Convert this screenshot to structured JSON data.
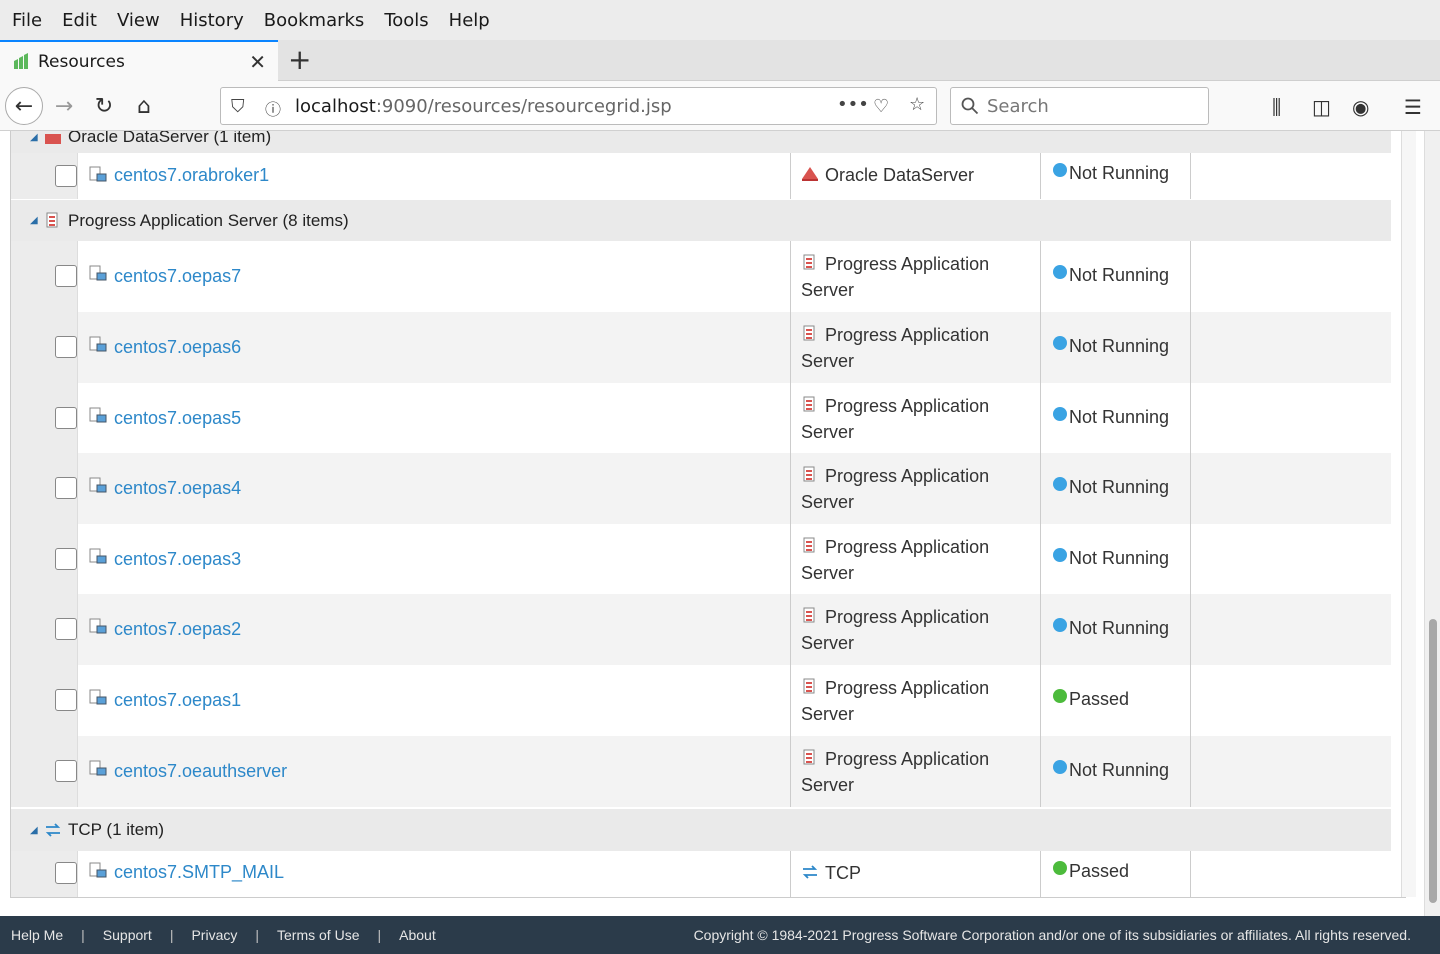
{
  "menu": [
    "File",
    "Edit",
    "View",
    "History",
    "Bookmarks",
    "Tools",
    "Help"
  ],
  "tab": {
    "title": "Resources"
  },
  "url": {
    "host": "localhost",
    "path": ":9090/resources/resourcegrid.jsp"
  },
  "search": {
    "placeholder": "Search"
  },
  "groups": [
    {
      "title": "Oracle DataServer (1 item)"
    },
    {
      "title": "Progress Application Server (8 items)"
    },
    {
      "title": "TCP (1 item)"
    }
  ],
  "rows": [
    {
      "name": "centos7.orabroker1",
      "type": "Oracle DataServer",
      "status": "Not Running"
    },
    {
      "name": "centos7.oepas7",
      "type": "Progress Application Server",
      "status": "Not Running"
    },
    {
      "name": "centos7.oepas6",
      "type": "Progress Application Server",
      "status": "Not Running"
    },
    {
      "name": "centos7.oepas5",
      "type": "Progress Application Server",
      "status": "Not Running"
    },
    {
      "name": "centos7.oepas4",
      "type": "Progress Application Server",
      "status": "Not Running"
    },
    {
      "name": "centos7.oepas3",
      "type": "Progress Application Server",
      "status": "Not Running"
    },
    {
      "name": "centos7.oepas2",
      "type": "Progress Application Server",
      "status": "Not Running"
    },
    {
      "name": "centos7.oepas1",
      "type": "Progress Application Server",
      "status": "Passed"
    },
    {
      "name": "centos7.oeauthserver",
      "type": "Progress Application Server",
      "status": "Not Running"
    },
    {
      "name": "centos7.SMTP_MAIL",
      "type": "TCP",
      "status": "Passed"
    }
  ],
  "status_colors": {
    "Not Running": "#3aa3e3",
    "Passed": "#4cbb3c"
  },
  "footer": {
    "links": [
      "Help Me",
      "Support",
      "Privacy",
      "Terms of Use",
      "About"
    ],
    "copyright": "Copyright © 1984-2021 Progress Software Corporation and/or one of its subsidiaries or affiliates. All rights reserved."
  }
}
